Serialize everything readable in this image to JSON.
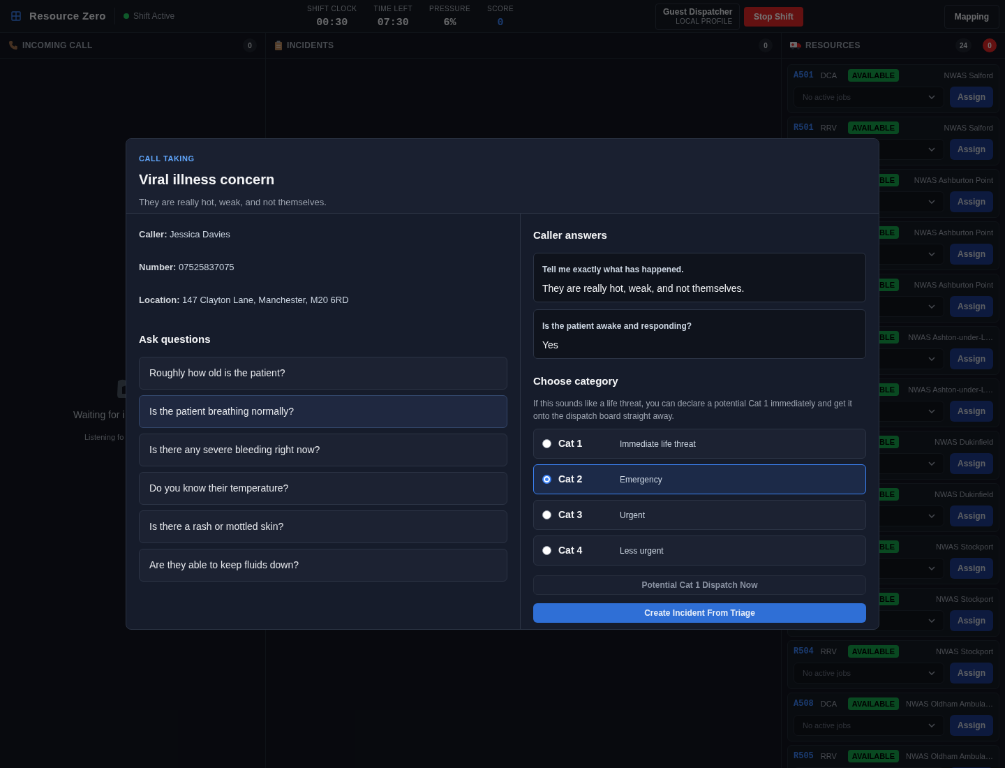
{
  "topbar": {
    "app_name": "Resource Zero",
    "shift_status": "Shift Active",
    "stats": [
      {
        "label": "SHIFT CLOCK",
        "value": "00:30",
        "kind": "plain"
      },
      {
        "label": "TIME LEFT",
        "value": "07:30",
        "kind": "plain"
      },
      {
        "label": "PRESSURE",
        "value": "6%",
        "kind": "plain"
      },
      {
        "label": "SCORE",
        "value": "0",
        "kind": "score"
      }
    ],
    "profile": {
      "name": "Guest Dispatcher",
      "type": "LOCAL PROFILE"
    },
    "stop_button": "Stop Shift",
    "mapping_button": "Mapping"
  },
  "incoming_call": {
    "title": "INCOMING CALL",
    "count": "0",
    "waiting_text": "Waiting for i",
    "listening_text": "Listening fo"
  },
  "incidents": {
    "title": "INCIDENTS",
    "count": "0"
  },
  "resources": {
    "title": "RESOURCES",
    "count": "24",
    "alert_count": "0",
    "units": [
      {
        "id": "A501",
        "type": "DCA",
        "status": "AVAILABLE",
        "location": "NWAS Salford",
        "jobs": "No active jobs",
        "assign": "Assign"
      },
      {
        "id": "R501",
        "type": "RRV",
        "status": "AVAILABLE",
        "location": "NWAS Salford",
        "assign": "Assign"
      },
      {
        "status": "BLE",
        "location": "NWAS Ashburton Point",
        "assign": "Assign"
      },
      {
        "status": "BLE",
        "location": "NWAS Ashburton Point",
        "assign": "Assign"
      },
      {
        "status": "BLE",
        "location": "NWAS Ashburton Point",
        "assign": "Assign"
      },
      {
        "status": "BLE",
        "location": "NWAS Ashton-under-L…",
        "assign": "Assign"
      },
      {
        "status": "BLE",
        "location": "NWAS Ashton-under-L…",
        "assign": "Assign"
      },
      {
        "status": "BLE",
        "location": "NWAS Dukinfield",
        "assign": "Assign"
      },
      {
        "status": "BLE",
        "location": "NWAS Dukinfield",
        "assign": "Assign"
      },
      {
        "status": "BLE",
        "location": "NWAS Stockport",
        "assign": "Assign"
      },
      {
        "status": "BLE",
        "location": "NWAS Stockport",
        "assign": "Assign"
      },
      {
        "id": "R504",
        "type": "RRV",
        "status": "AVAILABLE",
        "location": "NWAS Stockport",
        "jobs": "No active jobs",
        "assign": "Assign"
      },
      {
        "id": "A508",
        "type": "DCA",
        "status": "AVAILABLE",
        "location": "NWAS Oldham Ambula…",
        "jobs": "No active jobs",
        "assign": "Assign"
      },
      {
        "id": "R505",
        "type": "RRV",
        "status": "AVAILABLE",
        "location": "NWAS Oldham Ambula…"
      }
    ]
  },
  "modal": {
    "eyebrow": "CALL TAKING",
    "title": "Viral illness concern",
    "summary": "They are really hot, weak, and not themselves.",
    "details": [
      {
        "label": "Caller:",
        "value": "Jessica Davies"
      },
      {
        "label": "Number:",
        "value": "07525837075"
      },
      {
        "label": "Location:",
        "value": "147 Clayton Lane, Manchester, M20 6RD"
      }
    ],
    "questions_title": "Ask questions",
    "questions": [
      {
        "text": "Roughly how old is the patient?",
        "highlighted": false
      },
      {
        "text": "Is the patient breathing normally?",
        "highlighted": true
      },
      {
        "text": "Is there any severe bleeding right now?",
        "highlighted": false
      },
      {
        "text": "Do you know their temperature?",
        "highlighted": false
      },
      {
        "text": "Is there a rash or mottled skin?",
        "highlighted": false
      },
      {
        "text": "Are they able to keep fluids down?",
        "highlighted": false
      }
    ],
    "answers_title": "Caller answers",
    "answers": [
      {
        "question": "Tell me exactly what has happened.",
        "answer": "They are really hot, weak, and not themselves."
      },
      {
        "question": "Is the patient awake and responding?",
        "answer": "Yes"
      }
    ],
    "category_title": "Choose category",
    "category_hint": "If this sounds like a life threat, you can declare a potential Cat 1 immediately and get it onto the dispatch board straight away.",
    "categories": [
      {
        "name": "Cat 1",
        "description": "Immediate life threat",
        "selected": false
      },
      {
        "name": "Cat 2",
        "description": "Emergency",
        "selected": true
      },
      {
        "name": "Cat 3",
        "description": "Urgent",
        "selected": false
      },
      {
        "name": "Cat 4",
        "description": "Less urgent",
        "selected": false
      }
    ],
    "cat1_button": "Potential Cat 1 Dispatch Now",
    "create_button": "Create Incident From Triage"
  }
}
